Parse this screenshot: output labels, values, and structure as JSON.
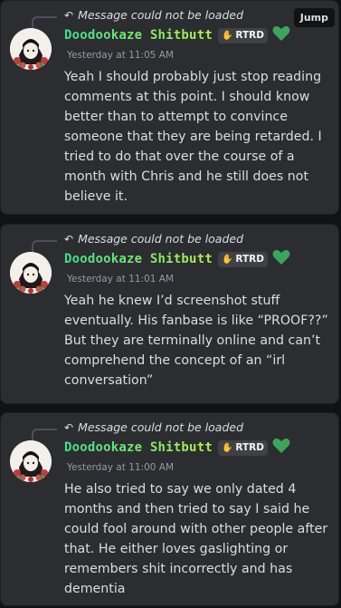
{
  "messages": [
    {
      "reply_text": "Message could not be loaded",
      "username": "Doodookaze Shitbutt",
      "tag": "RTRD",
      "timestamp": "Yesterday at 11:05 AM",
      "content": "Yeah I should probably just stop reading comments at this point. I should know better than to attempt to convince someone that they are being retarded. I tried to do that over the course of a month with Chris and he still does not believe it."
    },
    {
      "reply_text": "Message could not be loaded",
      "username": "Doodookaze Shitbutt",
      "tag": "RTRD",
      "timestamp": "Yesterday at 11:01 AM",
      "content": "Yeah he knew I’d screenshot stuff eventually. His fanbase is like “PROOF??” But they are terminally online and can’t comprehend the concept of an “irl conversation”"
    },
    {
      "reply_text": "Message could not be loaded",
      "username": "Doodookaze Shitbutt",
      "tag": "RTRD",
      "timestamp": "Yesterday at 11:00 AM",
      "content": "He also tried to say we only dated 4 months and then tried to say I said he could fool around with other people after that. He either loves gaslighting or remembers shit incorrectly and has dementia"
    }
  ],
  "jump_label": "Jump",
  "colors": {
    "background": "#111214",
    "card": "#2b2d31",
    "username_gradient_start": "#3fe38c",
    "username_gradient_end": "#b8f04a",
    "heart": "#3ba55c",
    "timestamp": "#949ba4"
  },
  "icons": [
    "reply-arrow-icon",
    "raised-hand-icon",
    "green-heart-icon",
    "avatar"
  ]
}
